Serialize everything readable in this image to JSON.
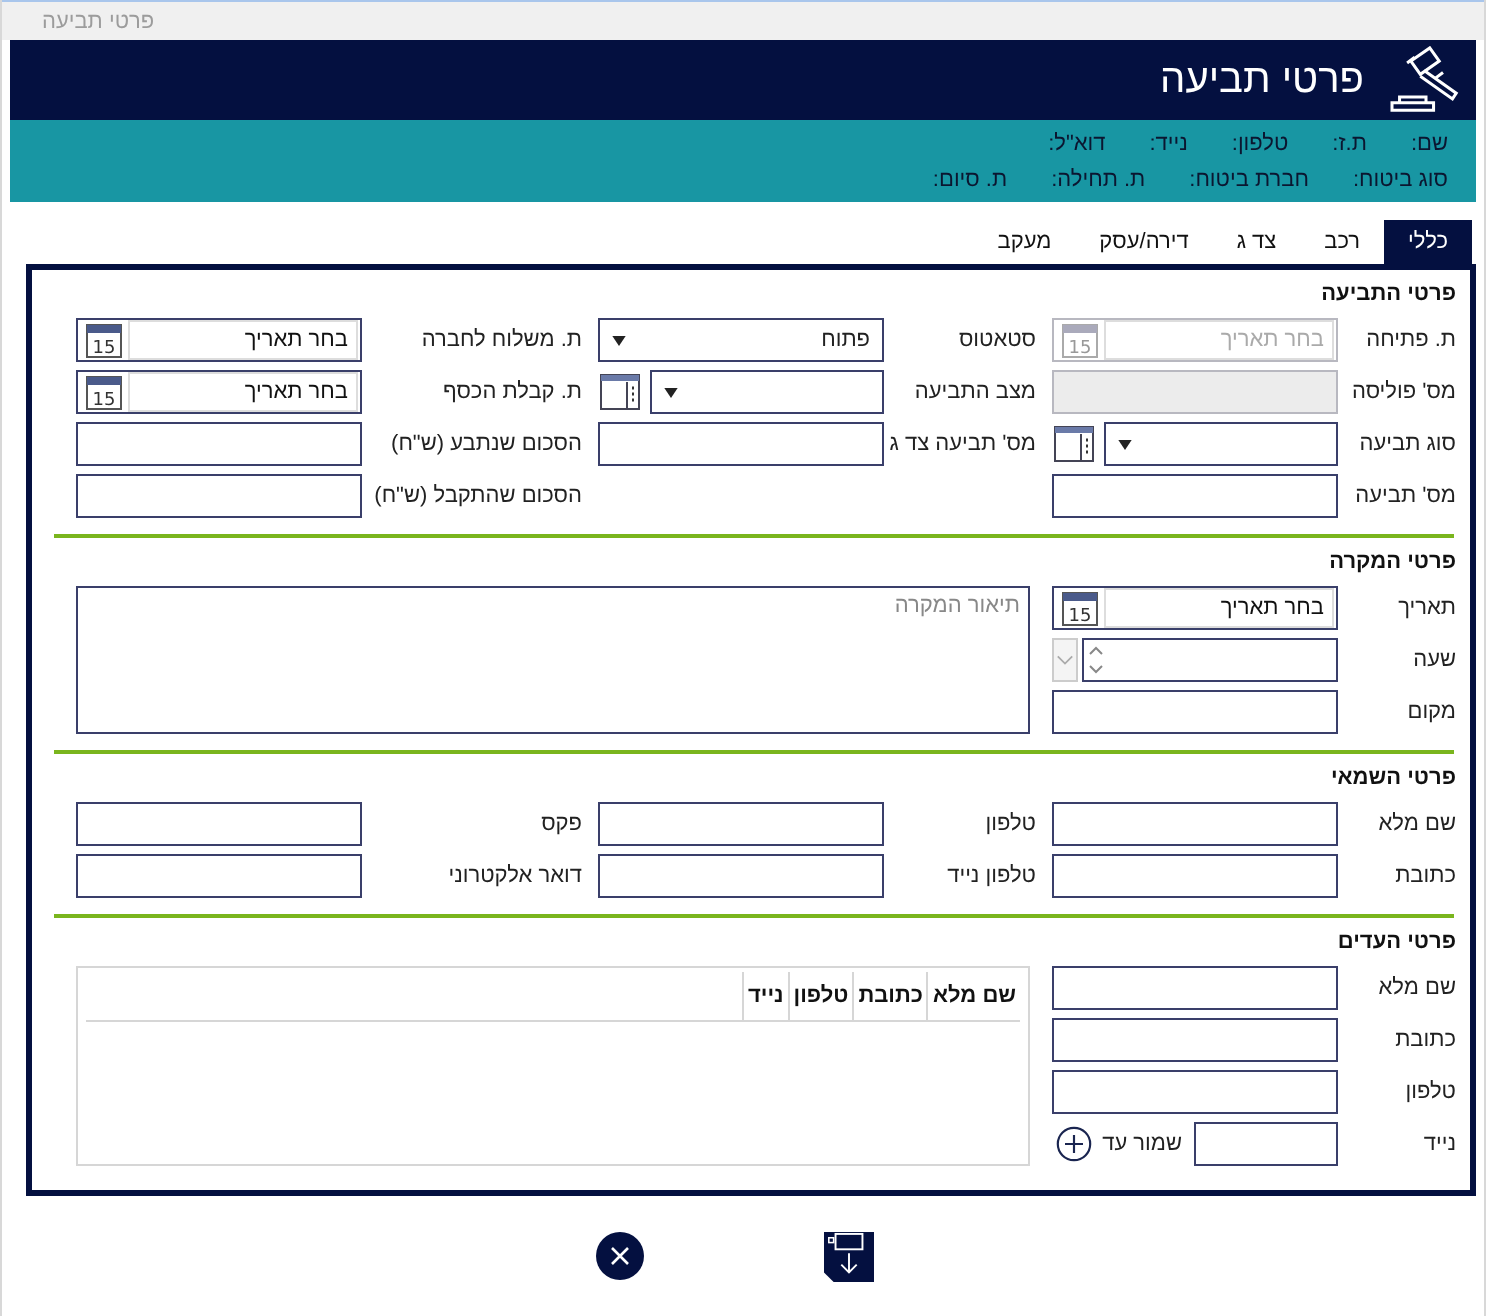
{
  "window": {
    "title": "פרטי תביעה"
  },
  "header": {
    "title": "פרטי תביעה"
  },
  "info_rows": [
    [
      "שם:",
      "ת.ז:",
      "טלפון:",
      "נייד:",
      "דוא\"ל:"
    ],
    [
      "סוג ביטוח:",
      "חברת ביטוח:",
      "ת. תחילה:",
      "ת. סיום:"
    ]
  ],
  "tabs": [
    {
      "label": "כללי",
      "selected": true
    },
    {
      "label": "רכב",
      "selected": false
    },
    {
      "label": "צד ג",
      "selected": false
    },
    {
      "label": "דירה/עסק",
      "selected": false
    },
    {
      "label": "מעקב",
      "selected": false
    }
  ],
  "sections": [
    {
      "title": "פרטי התביעה",
      "kind": "grid",
      "fields": [
        {
          "label": "ת. פתיחה",
          "kind": "date",
          "placeholder": "בחר תאריך",
          "icon_text": "15",
          "disabled": true
        },
        {
          "label": "סטאטוס",
          "kind": "select",
          "value": "פתוח",
          "disabled": false
        },
        {
          "label": "ת. משלוח לחברה",
          "kind": "date",
          "placeholder": "בחר תאריך",
          "icon_text": "15",
          "disabled": false
        },
        {
          "label": "מס' פוליסה",
          "kind": "input",
          "disabled": true
        },
        {
          "label": "מצב התביעה",
          "kind": "select_list",
          "disabled": false
        },
        {
          "label": "ת. קבלת הכסף",
          "kind": "date",
          "placeholder": "בחר תאריך",
          "icon_text": "15",
          "disabled": false
        },
        {
          "label": "סוג תביעה",
          "kind": "select_list",
          "disabled": false
        },
        {
          "label": "מס' תביעה צד ג",
          "kind": "input",
          "disabled": false
        },
        {
          "label": "הסכום שנתבע (ש\"ח)",
          "kind": "input",
          "disabled": false
        },
        {
          "label": "מס' תביעה",
          "kind": "input",
          "disabled": false
        },
        {
          "kind": "blank"
        },
        {
          "label": "הסכום שהתקבל (ש\"ח)",
          "kind": "input",
          "disabled": false
        }
      ]
    },
    {
      "title": "פרטי המקרה",
      "kind": "incident",
      "fields": [
        {
          "label": "תאריך",
          "kind": "date",
          "placeholder": "בחר תאריך",
          "icon_text": "15",
          "disabled": false
        },
        {
          "label": "שעה",
          "kind": "time",
          "disabled": false
        },
        {
          "label": "מקום",
          "kind": "input",
          "disabled": false
        }
      ],
      "description": {
        "placeholder": "תיאור המקרה"
      }
    },
    {
      "title": "פרטי השמאי",
      "kind": "grid",
      "fields": [
        {
          "label": "שם מלא",
          "kind": "input",
          "disabled": false
        },
        {
          "label": "טלפון",
          "kind": "input",
          "disabled": false
        },
        {
          "label": "פקס",
          "kind": "input",
          "disabled": false
        },
        {
          "label": "כתובת",
          "kind": "input",
          "disabled": false
        },
        {
          "label": "טלפון נייד",
          "kind": "input",
          "disabled": false
        },
        {
          "label": "דואר אלקטרוני",
          "kind": "input",
          "disabled": false
        }
      ]
    },
    {
      "title": "פרטי העדים",
      "kind": "witnesses",
      "fields": [
        {
          "label": "שם מלא",
          "kind": "input",
          "disabled": false
        },
        {
          "label": "כתובת",
          "kind": "input",
          "disabled": false
        },
        {
          "label": "טלפון",
          "kind": "input",
          "disabled": false
        },
        {
          "label": "נייד",
          "kind": "input_button",
          "button": "שמור עד",
          "disabled": false
        }
      ],
      "table": {
        "columns": [
          "שם מלא",
          "כתובת",
          "טלפון",
          "נייד"
        ]
      }
    }
  ],
  "actions": [
    {
      "kind": "save"
    },
    {
      "kind": "cancel"
    }
  ]
}
